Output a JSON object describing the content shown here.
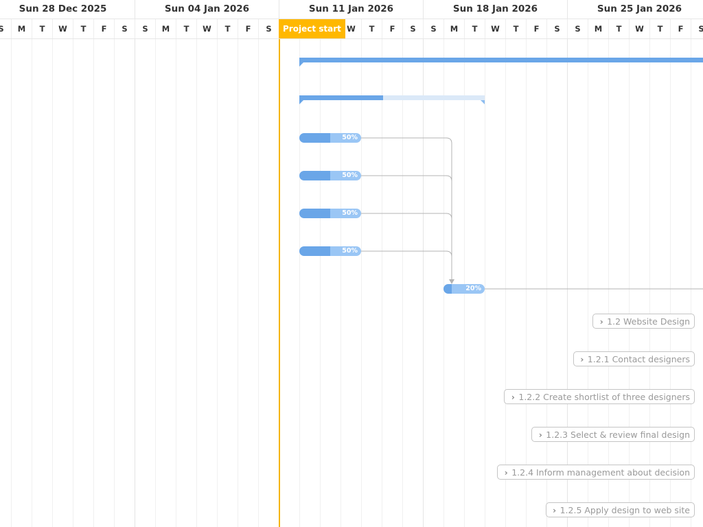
{
  "timeline": {
    "weeks": [
      "Sun 28 Dec 2025",
      "Sun 04 Jan 2026",
      "Sun 11 Jan 2026",
      "Sun 18 Jan 2026",
      "Sun 25 Jan 2026"
    ],
    "day_letters": [
      "S",
      "M",
      "T",
      "W",
      "T",
      "F",
      "S"
    ],
    "project_start_label": "Project start"
  },
  "tasks": [
    {
      "kind": "summary",
      "percent": 100
    },
    {
      "kind": "summary",
      "percent": 45
    },
    {
      "kind": "task",
      "percent": 50,
      "label": "50%"
    },
    {
      "kind": "task",
      "percent": 50,
      "label": "50%"
    },
    {
      "kind": "task",
      "percent": 50,
      "label": "50%"
    },
    {
      "kind": "task",
      "percent": 50,
      "label": "50%"
    },
    {
      "kind": "task",
      "percent": 20,
      "label": "20%"
    },
    {
      "kind": "chip",
      "label": "1.2 Website Design"
    },
    {
      "kind": "chip",
      "label": "1.2.1 Contact designers"
    },
    {
      "kind": "chip",
      "label": "1.2.2 Create shortlist of three designers"
    },
    {
      "kind": "chip",
      "label": "1.2.3 Select & review final design"
    },
    {
      "kind": "chip",
      "label": "1.2.4 Inform management about decision"
    },
    {
      "kind": "chip",
      "label": "1.2.5 Apply design to web site"
    }
  ],
  "colors": {
    "bar_progress": "#6aa6e8",
    "bar_remaining": "#9ac6f5",
    "project_start": "#ffb800",
    "link": "#b3b3b3"
  },
  "icons": {
    "chip_expand": "chevron-right-icon"
  }
}
